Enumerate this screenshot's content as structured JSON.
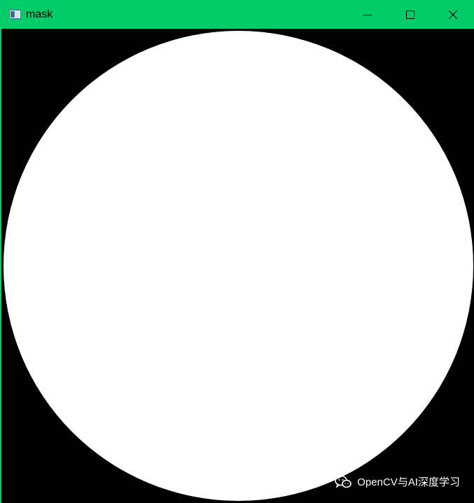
{
  "window": {
    "title": "mask",
    "titlebar_color": "#00cc6a",
    "controls": [
      "minimize-icon",
      "maximize-icon",
      "close-icon"
    ]
  },
  "image": {
    "background_color": "#000000",
    "circle_color": "#ffffff"
  },
  "watermark": {
    "icon": "wechat-icon",
    "text": "OpenCV与AI深度学习"
  }
}
